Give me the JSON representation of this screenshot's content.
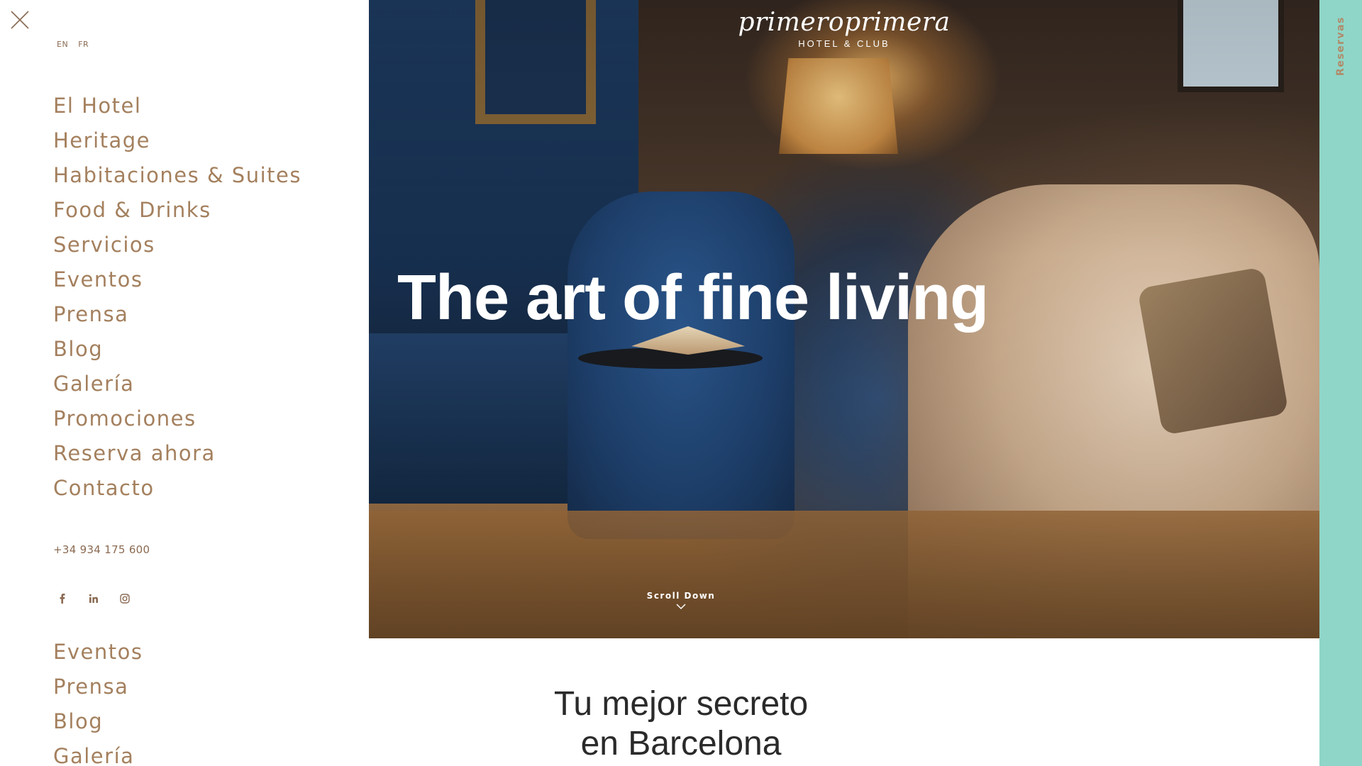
{
  "menu": {
    "languages": [
      "EN",
      "FR"
    ],
    "items": [
      "El Hotel",
      "Heritage",
      "Habitaciones & Suites",
      "Food & Drinks",
      "Servicios",
      "Eventos",
      "Prensa",
      "Blog",
      "Galería",
      "Promociones",
      "Reserva ahora",
      "Contacto"
    ],
    "phone": "+34 934 175 600",
    "social_icons": [
      "facebook-icon",
      "linkedin-icon",
      "instagram-icon"
    ],
    "secondary_items": [
      "Eventos",
      "Prensa",
      "Blog",
      "Galería"
    ]
  },
  "hero": {
    "logo_word": "primeroprimera",
    "logo_sub": "HOTEL & CLUB",
    "headline": "The art of fine living",
    "scroll_label": "Scroll Down"
  },
  "intro": {
    "title_line1": "Tu mejor secreto",
    "title_line2": "en Barcelona"
  },
  "reserve": {
    "label": "Reservas"
  },
  "colors": {
    "menu_text": "#a4805e",
    "reserve_bar": "#8fd6c8",
    "headline": "#ffffff"
  }
}
